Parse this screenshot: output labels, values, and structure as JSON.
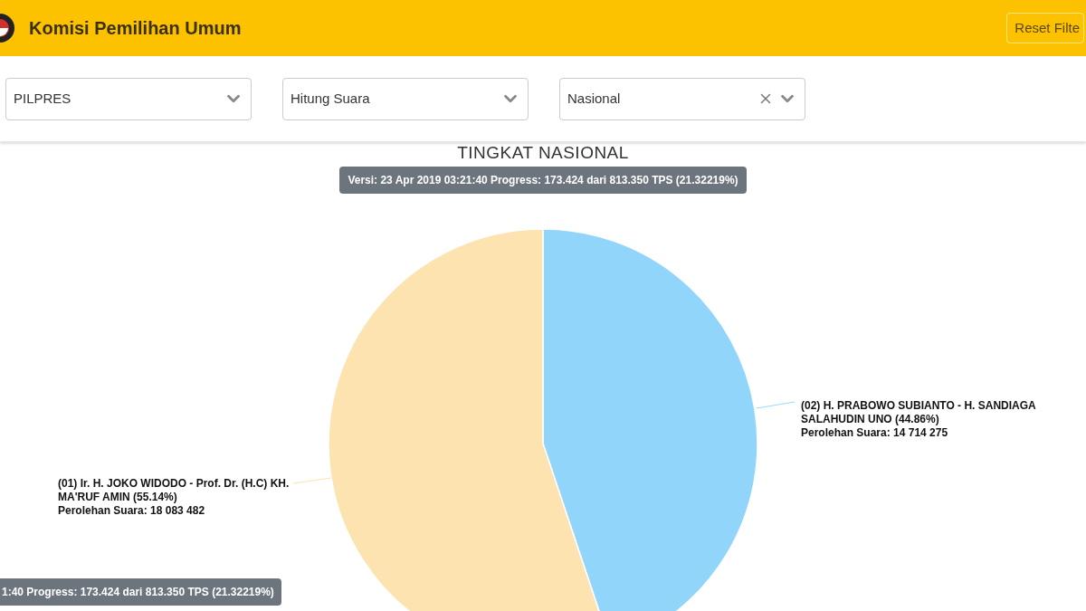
{
  "header": {
    "title": "Komisi Pemilihan Umum",
    "reset_button": "Reset Filte"
  },
  "filters": [
    {
      "value": "PILPRES",
      "clearable": false
    },
    {
      "value": "Hitung Suara",
      "clearable": false
    },
    {
      "value": "Nasional",
      "clearable": true
    }
  ],
  "chart": {
    "title": "TINGKAT NASIONAL",
    "version_badge": "Versi: 23 Apr 2019 03:21:40 Progress: 173.424 dari 813.350 TPS (21.32219%)",
    "candidates": [
      {
        "name": "(01) Ir. H. JOKO WIDODO - Prof. Dr. (H.C) KH. MA'RUF AMIN (55.14%)",
        "votes": "Perolehan Suara: 18 083 482",
        "color": "#fde3b0"
      },
      {
        "name": "(02) H. PRABOWO SUBIANTO - H. SANDIAGA SALAHUDIN UNO (44.86%)",
        "votes": "Perolehan Suara: 14 714 275",
        "color": "#91d5fb"
      }
    ],
    "chart_data": {
      "type": "pie",
      "series": [
        {
          "values": [
            55.14,
            44.86
          ]
        }
      ]
    },
    "tooltip": "1:40 Progress: 173.424 dari 813.350 TPS (21.32219%)"
  }
}
